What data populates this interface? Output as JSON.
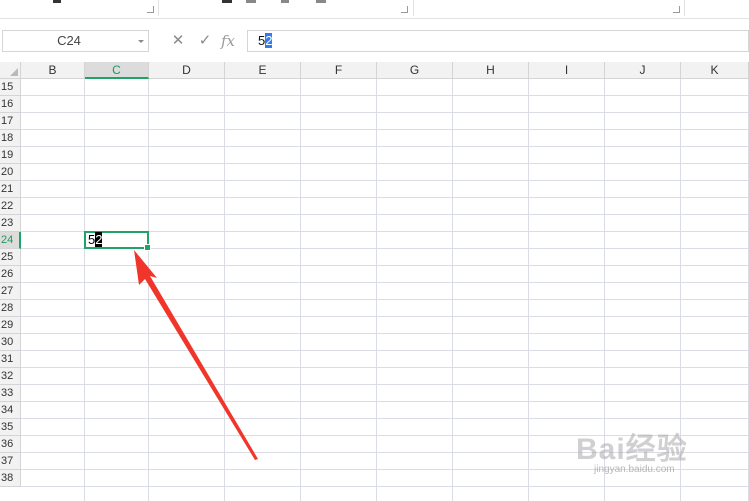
{
  "formula_bar": {
    "name_box": "C24",
    "cancel_icon": "✕",
    "confirm_icon": "✓",
    "fx_label": "fx",
    "value_plain": "5",
    "value_selected": "2"
  },
  "sheet": {
    "columns": [
      "B",
      "C",
      "D",
      "E",
      "F",
      "G",
      "H",
      "I",
      "J",
      "K"
    ],
    "active_column": "C",
    "rows": [
      "15",
      "16",
      "17",
      "18",
      "19",
      "20",
      "21",
      "22",
      "23",
      "24",
      "25",
      "26",
      "27",
      "28",
      "29",
      "30",
      "31",
      "32",
      "33",
      "34",
      "35",
      "36",
      "37",
      "38"
    ],
    "active_row": "24",
    "active_cell": {
      "text_plain": "5",
      "text_selected": "2"
    }
  },
  "annotation": {
    "arrow_color": "#f0362a"
  },
  "watermark": {
    "text": "Bai经验",
    "subtext": "jingyan.baidu.com"
  },
  "colors": {
    "selection_green": "#21a366",
    "text_selection": "#2f7cf6"
  }
}
